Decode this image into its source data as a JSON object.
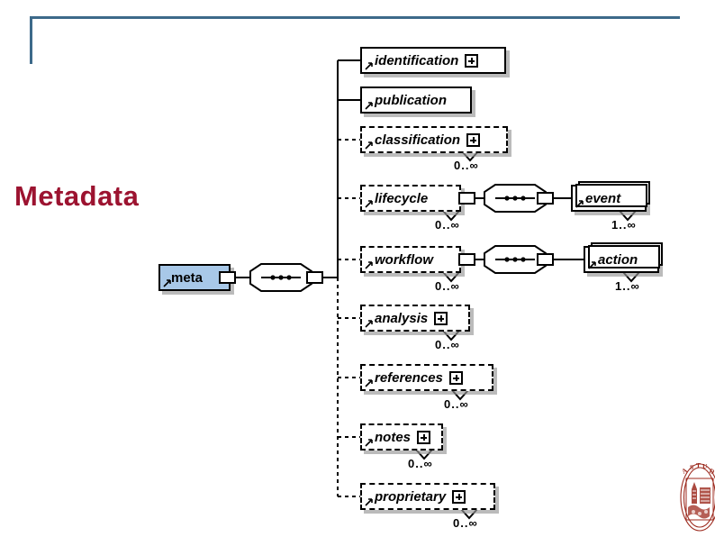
{
  "slide": {
    "title": "Metadata"
  },
  "header": {
    "rule_color": "#3d6a8a"
  },
  "colors": {
    "title": "#9c1330",
    "root_node_fill": "#a8c8e8",
    "node_fill": "#ffffff",
    "line": "#000000",
    "crest": "#9c2a1e"
  },
  "diagram": {
    "type": "xsd-schema-tree",
    "root": {
      "name": "meta",
      "label": "meta",
      "kind": "element",
      "occurrence": "",
      "compositor": "sequence",
      "icon": "element-arrow-icon"
    },
    "compositor_label": "sequence",
    "children": [
      {
        "label": "identification",
        "required": true,
        "expandable": true,
        "expander": "+",
        "cardinality": "",
        "stacked": false,
        "icon": "element-arrow-icon"
      },
      {
        "label": "publication",
        "required": true,
        "expandable": false,
        "expander": "",
        "cardinality": "",
        "stacked": false,
        "icon": "element-arrow-icon"
      },
      {
        "label": "classification",
        "required": false,
        "expandable": true,
        "expander": "+",
        "cardinality": "0..∞",
        "stacked": false,
        "icon": "element-arrow-icon"
      },
      {
        "label": "lifecycle",
        "required": false,
        "expandable": false,
        "expander": "",
        "cardinality": "0..∞",
        "stacked": false,
        "icon": "element-arrow-icon",
        "child": {
          "label": "event",
          "cardinality": "1..∞",
          "stacked": true,
          "required": true,
          "icon": "element-arrow-icon"
        }
      },
      {
        "label": "workflow",
        "required": false,
        "expandable": false,
        "expander": "",
        "cardinality": "0..∞",
        "stacked": false,
        "icon": "element-arrow-icon",
        "child": {
          "label": "action",
          "cardinality": "1..∞",
          "stacked": true,
          "required": true,
          "icon": "element-arrow-icon"
        }
      },
      {
        "label": "analysis",
        "required": false,
        "expandable": true,
        "expander": "+",
        "cardinality": "0..∞",
        "stacked": false,
        "icon": "element-arrow-icon"
      },
      {
        "label": "references",
        "required": false,
        "expandable": true,
        "expander": "+",
        "cardinality": "0..∞",
        "stacked": false,
        "icon": "element-arrow-icon"
      },
      {
        "label": "notes",
        "required": false,
        "expandable": true,
        "expander": "+",
        "cardinality": "0..∞",
        "stacked": false,
        "icon": "element-arrow-icon"
      },
      {
        "label": "proprietary",
        "required": false,
        "expandable": true,
        "expander": "+",
        "cardinality": "0..∞",
        "stacked": false,
        "icon": "element-arrow-icon"
      }
    ]
  },
  "logo": {
    "name": "university-crest",
    "alt": "crest"
  }
}
